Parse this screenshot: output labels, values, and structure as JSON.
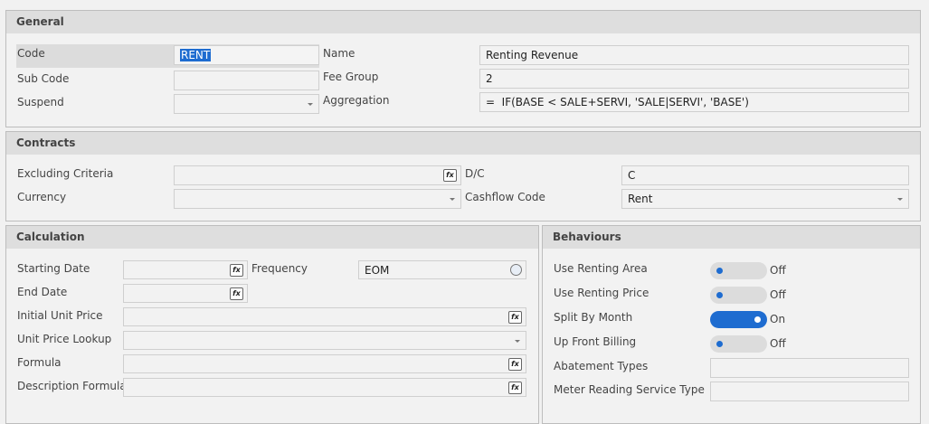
{
  "general": {
    "title": "General",
    "code_label": "Code",
    "code_value": "RENT",
    "subcode_label": "Sub Code",
    "subcode_value": "",
    "suspend_label": "Suspend",
    "suspend_value": "",
    "name_label": "Name",
    "name_value": "Renting Revenue",
    "feegroup_label": "Fee Group",
    "feegroup_value": "2",
    "aggregation_label": "Aggregation",
    "aggregation_value": "=  IF(BASE < SALE+SERVI, 'SALE|SERVI', 'BASE')"
  },
  "contracts": {
    "title": "Contracts",
    "excl_label": "Excluding Criteria",
    "excl_value": "",
    "currency_label": "Currency",
    "currency_value": "",
    "dc_label": "D/C",
    "dc_value": "C",
    "cashflow_label": "Cashflow Code",
    "cashflow_value": "Rent"
  },
  "calculation": {
    "title": "Calculation",
    "start_label": "Starting Date",
    "end_label": "End Date",
    "frequency_label": "Frequency",
    "frequency_value": "EOM",
    "iup_label": "Initial Unit Price",
    "upl_label": "Unit Price Lookup",
    "formula_label": "Formula",
    "descformula_label": "Description Formula",
    "fx": "fx"
  },
  "behaviours": {
    "title": "Behaviours",
    "toggles": [
      {
        "label": "Use Renting Area",
        "state": "Off"
      },
      {
        "label": "Use Renting Price",
        "state": "Off"
      },
      {
        "label": "Split By Month",
        "state": "On"
      },
      {
        "label": "Up Front Billing",
        "state": "Off"
      }
    ],
    "abatement_label": "Abatement Types",
    "meter_label": "Meter Reading Service Type"
  },
  "colors": {
    "accent": "#1e6cd0"
  }
}
